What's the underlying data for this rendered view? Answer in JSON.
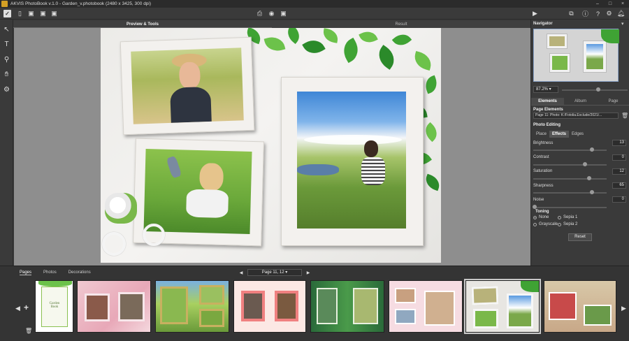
{
  "window": {
    "title": "AKVIS PhotoBook v.1.0 - Garden_v.photobook (2480 x 3425, 300 dpi)",
    "buttons": [
      "–",
      "□",
      "×"
    ]
  },
  "canvas_tabs": {
    "preview": "Preview & Tools",
    "result": "Result"
  },
  "navigator": {
    "title": "Navigator",
    "zoom": "87.2%",
    "zoom_level": 0.55
  },
  "right_tabs": [
    "Elements",
    "Album",
    "Page"
  ],
  "page_elements": {
    "title": "Page Elements",
    "value": "Page 11: Photo: K:/Fotolia.Exclude/2021/..."
  },
  "photo_editing": {
    "title": "Photo Editing",
    "tabs": [
      "Place",
      "Effects",
      "Edges"
    ],
    "params": [
      {
        "label": "Brightness",
        "value": "13",
        "level": 0.8
      },
      {
        "label": "Contrast",
        "value": "0",
        "level": 0.7
      },
      {
        "label": "Saturation",
        "value": "12",
        "level": 0.76
      },
      {
        "label": "Sharpness",
        "value": "65",
        "level": 0.8
      },
      {
        "label": "Noise",
        "value": "0",
        "level": 0.02
      }
    ],
    "toning": {
      "title": "Toning",
      "options": [
        "None",
        "Sepia 1",
        "Grayscale",
        "Sepia 2"
      ],
      "selected": "None"
    },
    "reset": "Reset"
  },
  "bottom": {
    "tabs": [
      "Pages",
      "Photos",
      "Decorations"
    ],
    "active_tab": "Pages",
    "page_selector": "Page 11, 12",
    "first_thumb_text": "Garden\nBook"
  },
  "colors": {
    "background": "#3c3c3c",
    "panel": "#3a3a3a",
    "accent": "#8aa4c8"
  }
}
